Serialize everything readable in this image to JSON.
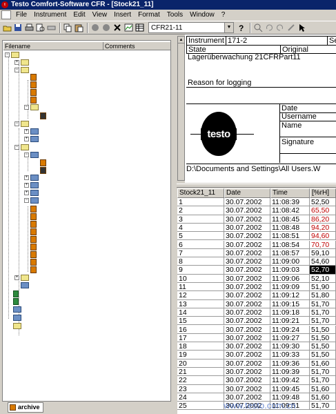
{
  "window": {
    "title": "Testo Comfort-Software CFR - [Stock21_11]",
    "app_icon": "testo-logo-icon"
  },
  "menu": {
    "items": [
      "File",
      "Instrument",
      "Edit",
      "View",
      "Insert",
      "Format",
      "Tools",
      "Window",
      "?"
    ]
  },
  "toolbar": {
    "combo_value": "CFR21-11",
    "icons": [
      "open-icon",
      "save-icon",
      "print-icon",
      "print-preview-icon",
      "fax-icon",
      "copy-icon",
      "paste-icon",
      "record-icon",
      "stop-icon",
      "close-x-icon",
      "chart-icon",
      "table-icon",
      "help-icon",
      "zoom-in-icon",
      "rotate-left-icon",
      "rotate-right-icon",
      "cursor-icon"
    ]
  },
  "explorer": {
    "columns": [
      "Filename",
      "Comments"
    ],
    "tab_label": "archive"
  },
  "document": {
    "instrument_label": "Instrument",
    "instrument_value": "171-2",
    "instrument_extra": "Se",
    "state_label": "State",
    "original_label": "Original",
    "description": "Lagerüberwachung 21CFRPart11",
    "reason_label": "Reason for logging",
    "logo_text": "testo",
    "fields": [
      "Date",
      "Username",
      "Name",
      "Signature"
    ],
    "path": "D:\\Documents and Settings\\All Users.W"
  },
  "table": {
    "headers": [
      "Stock21_11",
      "Date",
      "Time",
      "[%rH]"
    ],
    "rows": [
      [
        "1",
        "30.07.2002",
        "11:08:39",
        "52,50"
      ],
      [
        "2",
        "30.07.2002",
        "11:08:42",
        "65,50"
      ],
      [
        "3",
        "30.07.2002",
        "11:08:45",
        "86,20"
      ],
      [
        "4",
        "30.07.2002",
        "11:08:48",
        "94,20"
      ],
      [
        "5",
        "30.07.2002",
        "11:08:51",
        "94,60"
      ],
      [
        "6",
        "30.07.2002",
        "11:08:54",
        "70,70"
      ],
      [
        "7",
        "30.07.2002",
        "11:08:57",
        "59,10"
      ],
      [
        "8",
        "30.07.2002",
        "11:09:00",
        "54,60"
      ],
      [
        "9",
        "30.07.2002",
        "11:09:03",
        "52,70"
      ],
      [
        "10",
        "30.07.2002",
        "11:09:06",
        "52,10"
      ],
      [
        "11",
        "30.07.2002",
        "11:09:09",
        "51,90"
      ],
      [
        "12",
        "30.07.2002",
        "11:09:12",
        "51,80"
      ],
      [
        "13",
        "30.07.2002",
        "11:09:15",
        "51,70"
      ],
      [
        "14",
        "30.07.2002",
        "11:09:18",
        "51,70"
      ],
      [
        "15",
        "30.07.2002",
        "11:09:21",
        "51,70"
      ],
      [
        "16",
        "30.07.2002",
        "11:09:24",
        "51,50"
      ],
      [
        "17",
        "30.07.2002",
        "11:09:27",
        "51,50"
      ],
      [
        "18",
        "30.07.2002",
        "11:09:30",
        "51,50"
      ],
      [
        "19",
        "30.07.2002",
        "11:09:33",
        "51,50"
      ],
      [
        "20",
        "30.07.2002",
        "11:09:36",
        "51,60"
      ],
      [
        "21",
        "30.07.2002",
        "11:09:39",
        "51,70"
      ],
      [
        "22",
        "30.07.2002",
        "11:09:42",
        "51,70"
      ],
      [
        "23",
        "30.07.2002",
        "11:09:45",
        "51,60"
      ],
      [
        "24",
        "30.07.2002",
        "11:09:48",
        "51,60"
      ],
      [
        "25",
        "30.07.2002",
        "11:09:51",
        "51,70"
      ]
    ],
    "red_rows": [
      2,
      3,
      4,
      5,
      6
    ],
    "selected_row": 9,
    "alarm_color": "#c00000"
  },
  "watermark": "www.testo.com.cn"
}
